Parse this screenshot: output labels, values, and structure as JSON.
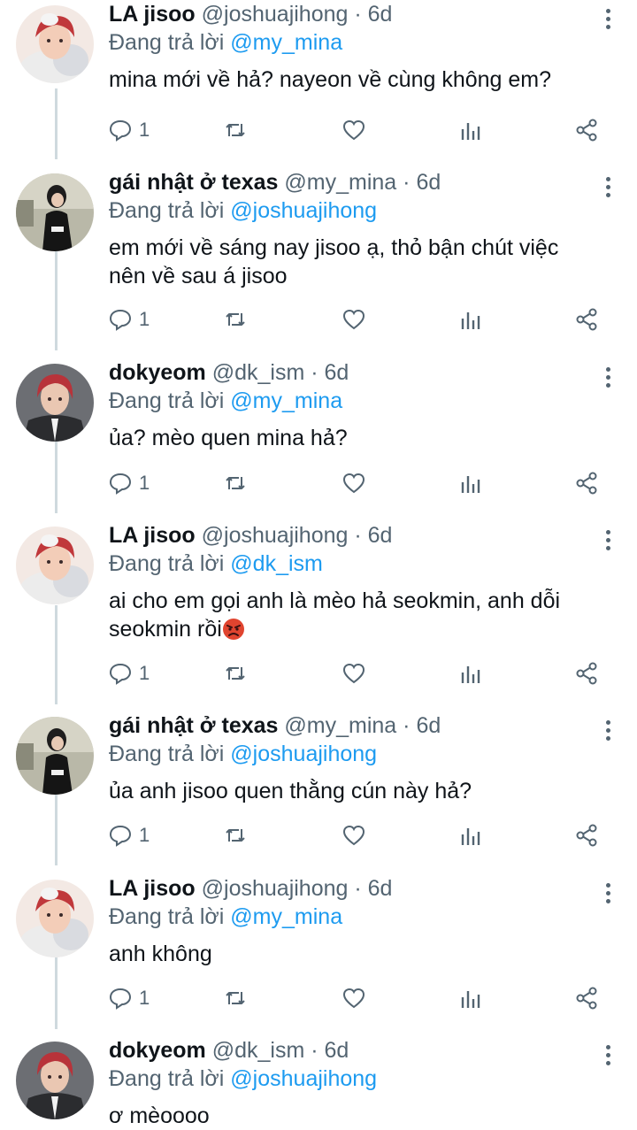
{
  "reply_label": "Đang trả lời",
  "colors": {
    "text": "#0f1419",
    "muted": "#536471",
    "link": "#1d9bf0",
    "thread_line": "#cfd9de"
  },
  "tweets": [
    {
      "name": "LA jisoo",
      "handle": "@joshuajihong",
      "sep": "·",
      "time": "6d",
      "reply_to": "@my_mina",
      "lines": [
        "mina mới về hả? nayeon về cùng không em?"
      ],
      "emoji": "",
      "reply_count": "1",
      "avatar": "redhead-plush"
    },
    {
      "name": "gái nhật ở texas",
      "handle": "@my_mina",
      "sep": "·",
      "time": "6d",
      "reply_to": "@joshuajihong",
      "lines": [
        "em mới về sáng nay jisoo ạ, thỏ bận chút việc",
        "nên về sau á jisoo"
      ],
      "emoji": "",
      "reply_count": "1",
      "avatar": "girl-outdoor"
    },
    {
      "name": "dokyeom",
      "handle": "@dk_ism",
      "sep": "·",
      "time": "6d",
      "reply_to": "@my_mina",
      "lines": [
        "ủa? mèo quen mina hả?"
      ],
      "emoji": "",
      "reply_count": "1",
      "avatar": "redhead-suit"
    },
    {
      "name": "LA jisoo",
      "handle": "@joshuajihong",
      "sep": "·",
      "time": "6d",
      "reply_to": "@dk_ism",
      "lines": [
        "ai cho em gọi anh là mèo hả seokmin, anh dỗi",
        "seokmin rồi"
      ],
      "emoji": "angry-face",
      "reply_count": "1",
      "avatar": "redhead-plush"
    },
    {
      "name": "gái nhật ở texas",
      "handle": "@my_mina",
      "sep": "·",
      "time": "6d",
      "reply_to": "@joshuajihong",
      "lines": [
        "ủa anh jisoo quen thằng cún này hả?"
      ],
      "emoji": "",
      "reply_count": "1",
      "avatar": "girl-outdoor"
    },
    {
      "name": "LA jisoo",
      "handle": "@joshuajihong",
      "sep": "·",
      "time": "6d",
      "reply_to": "@my_mina",
      "lines": [
        "anh không"
      ],
      "emoji": "",
      "reply_count": "1",
      "avatar": "redhead-plush"
    },
    {
      "name": "dokyeom",
      "handle": "@dk_ism",
      "sep": "·",
      "time": "6d",
      "reply_to": "@joshuajihong",
      "lines": [
        "ơ mèoooo"
      ],
      "emoji": "",
      "reply_count": "",
      "avatar": "redhead-suit"
    }
  ],
  "icons": {
    "reply": "reply-icon",
    "retweet": "retweet-icon",
    "like": "heart-icon",
    "analytics": "analytics-icon",
    "share": "share-icon",
    "more": "more-options-icon"
  }
}
